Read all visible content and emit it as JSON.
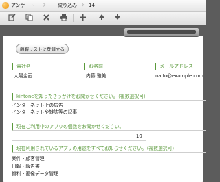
{
  "breadcrumb": {
    "app_name": "アンケート",
    "view_name": "絞り込み",
    "record_id": "14"
  },
  "toolbar": {
    "icons": [
      "edit-icon",
      "copy-icon",
      "delete-icon",
      "print-icon",
      "add-icon",
      "prev-icon",
      "next-icon"
    ]
  },
  "form": {
    "register_button": "顧客リストに登録する",
    "fields": [
      {
        "label": "貴社名",
        "value": "太陽企画"
      },
      {
        "label": "お名前",
        "value": "内藤 雅美"
      },
      {
        "label": "メールアドレス",
        "value": "naito@example.com"
      }
    ],
    "q1": {
      "label": "kintoneを知ったきっかけをお聞かせください。（複数選択可）",
      "answers": [
        "インターネット上の広告",
        "インターネットや雑誌等の記事"
      ]
    },
    "q2": {
      "label": "現在ご利用中のアプリの個数をお聞かせください。",
      "value": "10"
    },
    "q3": {
      "label": "現在利用されているアプリの用途をすべてお知らせください。（複数選択可）",
      "answers": [
        "案件・顧客管理",
        "日報・報告書",
        "資料・画像データ管理"
      ]
    }
  },
  "colors": {
    "accent": "#5b9a3c",
    "background": "#5c5c5c"
  }
}
